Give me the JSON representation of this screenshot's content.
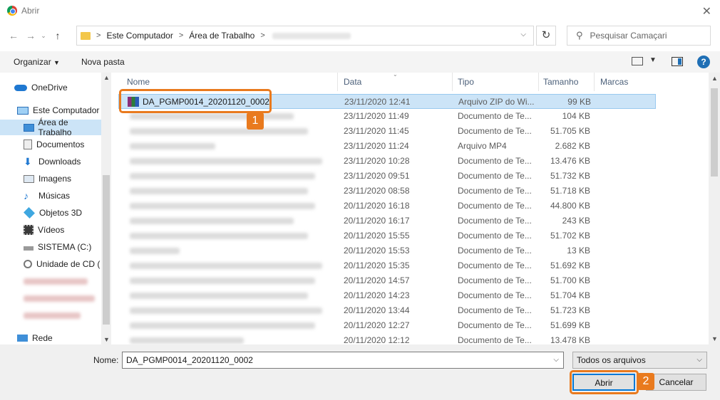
{
  "window": {
    "title": "Abrir"
  },
  "address": {
    "crumbs": [
      "Este Computador",
      "Área de Trabalho"
    ]
  },
  "search": {
    "placeholder": "Pesquisar Camaçari"
  },
  "toolbar": {
    "organize": "Organizar",
    "new_folder": "Nova pasta"
  },
  "sidebar": {
    "items": [
      {
        "label": "OneDrive",
        "icon": "cloud-icon"
      },
      {
        "label": "Este Computador",
        "icon": "computer-icon"
      },
      {
        "label": "Área de Trabalho",
        "icon": "desktop-icon",
        "selected": true
      },
      {
        "label": "Documentos",
        "icon": "documents-icon"
      },
      {
        "label": "Downloads",
        "icon": "download-icon"
      },
      {
        "label": "Imagens",
        "icon": "images-icon"
      },
      {
        "label": "Músicas",
        "icon": "music-icon"
      },
      {
        "label": "Objetos 3D",
        "icon": "cube-icon"
      },
      {
        "label": "Vídeos",
        "icon": "video-icon"
      },
      {
        "label": "SISTEMA (C:)",
        "icon": "drive-icon"
      },
      {
        "label": "Unidade de CD (",
        "icon": "cd-drive-icon"
      },
      {
        "label": "Rede",
        "icon": "network-icon"
      }
    ]
  },
  "columns": {
    "name": "Nome",
    "date": "Data",
    "type": "Tipo",
    "size": "Tamanho",
    "tags": "Marcas"
  },
  "files": [
    {
      "name": "DA_PGMP0014_20201120_0002",
      "date": "23/11/2020 12:41",
      "type": "Arquivo ZIP do Wi...",
      "size": "99 KB",
      "selected": true
    },
    {
      "name": "",
      "date": "23/11/2020 11:49",
      "type": "Documento de Te...",
      "size": "104 KB"
    },
    {
      "name": "",
      "date": "23/11/2020 11:45",
      "type": "Documento de Te...",
      "size": "51.705 KB"
    },
    {
      "name": "",
      "date": "23/11/2020 11:24",
      "type": "Arquivo MP4",
      "size": "2.682 KB"
    },
    {
      "name": "",
      "date": "23/11/2020 10:28",
      "type": "Documento de Te...",
      "size": "13.476 KB"
    },
    {
      "name": "",
      "date": "23/11/2020 09:51",
      "type": "Documento de Te...",
      "size": "51.732 KB"
    },
    {
      "name": "",
      "date": "23/11/2020 08:58",
      "type": "Documento de Te...",
      "size": "51.718 KB"
    },
    {
      "name": "",
      "date": "20/11/2020 16:18",
      "type": "Documento de Te...",
      "size": "44.800 KB"
    },
    {
      "name": "",
      "date": "20/11/2020 16:17",
      "type": "Documento de Te...",
      "size": "243 KB"
    },
    {
      "name": "",
      "date": "20/11/2020 15:55",
      "type": "Documento de Te...",
      "size": "51.702 KB"
    },
    {
      "name": "",
      "date": "20/11/2020 15:53",
      "type": "Documento de Te...",
      "size": "13 KB"
    },
    {
      "name": "",
      "date": "20/11/2020 15:35",
      "type": "Documento de Te...",
      "size": "51.692 KB"
    },
    {
      "name": "",
      "date": "20/11/2020 14:57",
      "type": "Documento de Te...",
      "size": "51.700 KB"
    },
    {
      "name": "",
      "date": "20/11/2020 14:23",
      "type": "Documento de Te...",
      "size": "51.704 KB"
    },
    {
      "name": "",
      "date": "20/11/2020 13:44",
      "type": "Documento de Te...",
      "size": "51.723 KB"
    },
    {
      "name": "",
      "date": "20/11/2020 12:27",
      "type": "Documento de Te...",
      "size": "51.699 KB"
    },
    {
      "name": "",
      "date": "20/11/2020 12:12",
      "type": "Documento de Te...",
      "size": "13.478 KB"
    }
  ],
  "footer": {
    "name_label": "Nome:",
    "name_value": "DA_PGMP0014_20201120_0002",
    "filter": "Todos os arquivos",
    "open": "Abrir",
    "cancel": "Cancelar"
  },
  "callouts": {
    "one": "1",
    "two": "2"
  },
  "colors": {
    "accent": "#0078d7",
    "callout": "#e97a1e",
    "selection": "#cce4f7"
  }
}
